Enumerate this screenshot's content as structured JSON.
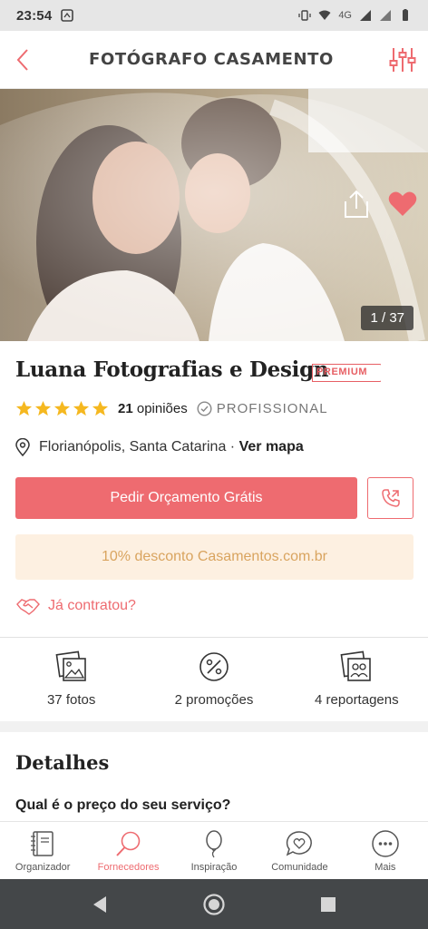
{
  "status_bar": {
    "time": "23:54",
    "network": "4G"
  },
  "header": {
    "title": "FOTÓGRAFO CASAMENTO"
  },
  "gallery": {
    "counter": "1 / 37"
  },
  "vendor": {
    "name": "Luana Fotografias e Design",
    "badge": "PREMIUM",
    "rating_stars": 5,
    "reviews_count": "21",
    "reviews_word": "opiniões",
    "professional": "PROFISSIONAL",
    "location": "Florianópolis, Santa Catarina",
    "separator": "·",
    "map_link": "Ver mapa"
  },
  "actions": {
    "quote_button": "Pedir Orçamento Grátis",
    "discount": "10% desconto Casamentos.com.br",
    "hired": "Já contratou?"
  },
  "stats": [
    {
      "icon": "photos-icon",
      "label": "37 fotos"
    },
    {
      "icon": "percent-icon",
      "label": "2 promoções"
    },
    {
      "icon": "album-icon",
      "label": "4 reportagens"
    }
  ],
  "details": {
    "title": "Detalhes",
    "question": "Qual é o preço do seu serviço?"
  },
  "bottom_nav": [
    {
      "icon": "notebook-icon",
      "label": "Organizador",
      "active": false
    },
    {
      "icon": "magnifier-icon",
      "label": "Fornecedores",
      "active": true
    },
    {
      "icon": "balloon-icon",
      "label": "Inspiração",
      "active": false
    },
    {
      "icon": "chat-heart-icon",
      "label": "Comunidade",
      "active": false
    },
    {
      "icon": "more-icon",
      "label": "Mais",
      "active": false
    }
  ],
  "colors": {
    "accent": "#ee6b70",
    "star": "#f5b820",
    "discount_bg": "#fdf0e1",
    "discount_text": "#d9a45f"
  }
}
